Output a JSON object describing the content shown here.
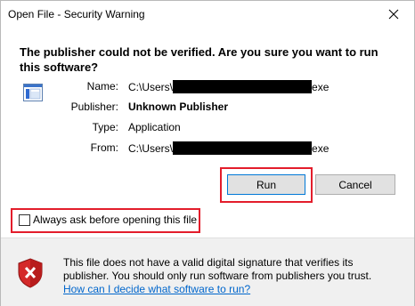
{
  "window": {
    "title": "Open File - Security Warning"
  },
  "headline": "The publisher could not be verified.  Are you sure you want to run this software?",
  "details": {
    "name_label": "Name:",
    "name_prefix": "C:\\Users\\",
    "name_suffix": "exe",
    "publisher_label": "Publisher:",
    "publisher_value": "Unknown Publisher",
    "type_label": "Type:",
    "type_value": "Application",
    "from_label": "From:",
    "from_prefix": "C:\\Users\\",
    "from_suffix": "exe"
  },
  "buttons": {
    "run": "Run",
    "cancel": "Cancel"
  },
  "checkbox": {
    "label": "Always ask before opening this file",
    "checked": false
  },
  "footer": {
    "warning_line1": "This file does not have a valid digital signature that verifies its",
    "warning_line2": "publisher.  You should only run software from publishers you trust.",
    "link_text": "How can I decide what software to run?"
  },
  "colors": {
    "highlight": "#e31d2b",
    "link": "#0066cc",
    "footer_bg": "#f0f0f0",
    "button_bg": "#e1e1e1"
  },
  "icons": {
    "file": "application-window-icon",
    "shield": "security-shield-error-icon",
    "close": "close-icon"
  }
}
